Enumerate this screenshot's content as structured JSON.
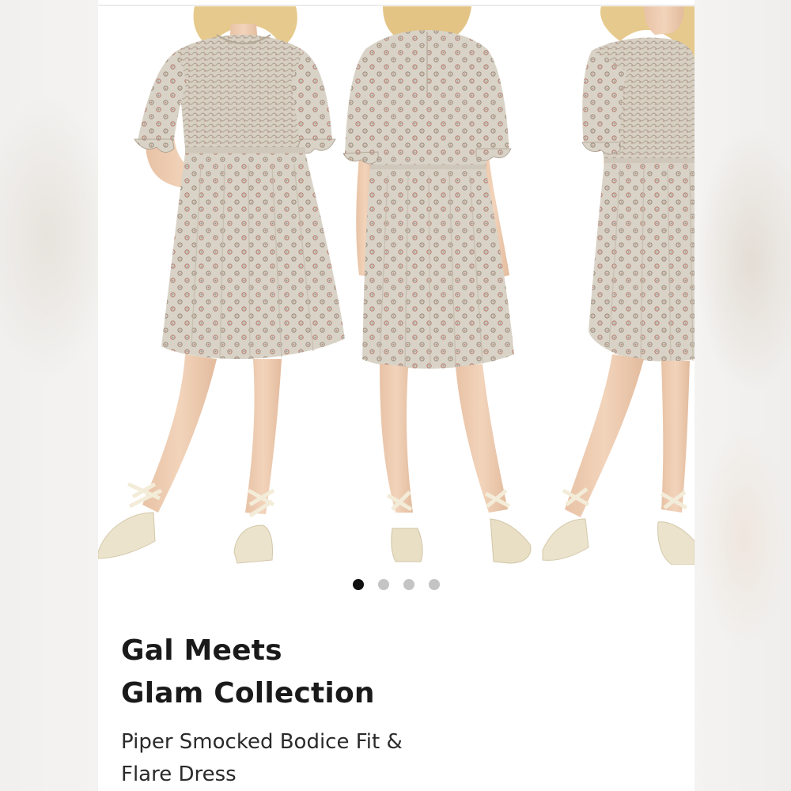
{
  "listing": {
    "brand_line_1": "Gal Meets",
    "brand_line_2": "Glam Collection",
    "title_line_1": "Piper Smocked Bodice Fit &",
    "title_line_2": "Flare Dress"
  },
  "carousel": {
    "dots": [
      {
        "label": "image-1",
        "active": true
      },
      {
        "label": "image-2",
        "active": false
      },
      {
        "label": "image-3",
        "active": false
      },
      {
        "label": "image-4",
        "active": false
      }
    ],
    "views": [
      "front",
      "back",
      "side"
    ]
  },
  "colors": {
    "dress": "#d8d2c6",
    "pattern_red": "#b98476",
    "pattern_teal": "#7c9893",
    "skin": "#efcdb1",
    "hair": "#e7c98a",
    "shoe": "#ece3cc",
    "active_dot": "#111111",
    "inactive_dot": "#c4c4c4"
  }
}
